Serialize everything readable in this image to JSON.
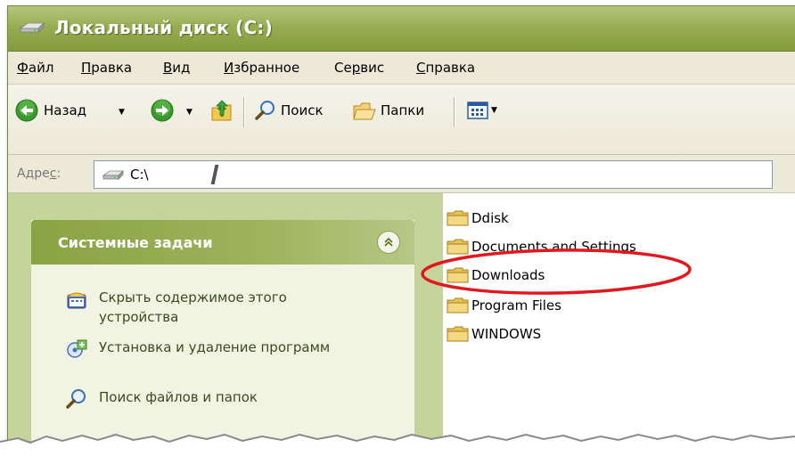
{
  "window": {
    "title": "Локальный диск (C:)",
    "title_icon": "drive-icon"
  },
  "menu": {
    "items": [
      {
        "label_ul": "Ф",
        "label_rest": "айл"
      },
      {
        "label_ul": "П",
        "label_rest": "равка"
      },
      {
        "label_ul": "В",
        "label_rest": "ид"
      },
      {
        "label_ul": "И",
        "label_rest": "збранное"
      },
      {
        "label_pre": "Се",
        "label_ul": "р",
        "label_rest": "вис"
      },
      {
        "label_ul": "С",
        "label_rest": "правка"
      }
    ]
  },
  "toolbar": {
    "back_label": "Назад",
    "search_label": "Поиск",
    "folders_label": "Папки"
  },
  "address": {
    "label_pre": "Адре",
    "label_ul": "с",
    "label_post": ":",
    "value": "C:\\"
  },
  "tasks": {
    "title": "Системные задачи",
    "items": [
      {
        "label": "Скрыть содержимое этого устройства",
        "icon": "hide-contents-icon"
      },
      {
        "label": "Установка и удаление программ",
        "icon": "add-remove-programs-icon"
      },
      {
        "label": "Поиск файлов и папок",
        "icon": "search-icon"
      }
    ]
  },
  "folders": {
    "items": [
      {
        "label": "Ddisk"
      },
      {
        "label": "Documents and Settings"
      },
      {
        "label": "Downloads",
        "highlighted": true
      },
      {
        "label": "Program Files"
      },
      {
        "label": "WINDOWS"
      }
    ]
  },
  "colors": {
    "title_bar": "#97ad52",
    "left_pane": "#c4d49b",
    "highlight": "#e0191e",
    "folder": "#f2d27a"
  }
}
